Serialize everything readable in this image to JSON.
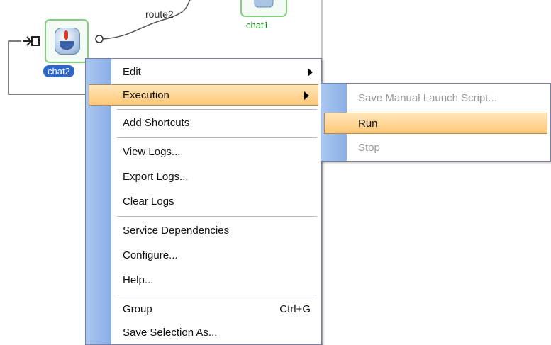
{
  "canvas": {
    "route_label": "route2",
    "nodes": [
      {
        "label": "chat1"
      },
      {
        "label": "chat2"
      }
    ]
  },
  "context_menu": {
    "items": [
      {
        "label": "Edit",
        "submenu": true
      },
      {
        "label": "Execution",
        "submenu": true,
        "highlighted": true
      },
      {
        "label": "Add Shortcuts"
      },
      {
        "label": "View Logs..."
      },
      {
        "label": "Export Logs..."
      },
      {
        "label": "Clear Logs"
      },
      {
        "label": "Service Dependencies"
      },
      {
        "label": "Configure..."
      },
      {
        "label": "Help..."
      },
      {
        "label": "Group",
        "shortcut": "Ctrl+G"
      },
      {
        "label": "Save Selection As..."
      }
    ]
  },
  "execution_submenu": {
    "items": [
      {
        "label": "Save Manual Launch Script...",
        "disabled": true
      },
      {
        "label": "Run",
        "highlighted": true
      },
      {
        "label": "Stop",
        "disabled": true
      }
    ]
  },
  "colors": {
    "highlight": "#ffc878",
    "menu_gutter": "#8aaee6",
    "node_border": "#7fcf7f",
    "selected_label": "#2e66c8"
  },
  "icons": [
    "java-service-icon",
    "submenu-arrow-icon",
    "connector-icon"
  ]
}
